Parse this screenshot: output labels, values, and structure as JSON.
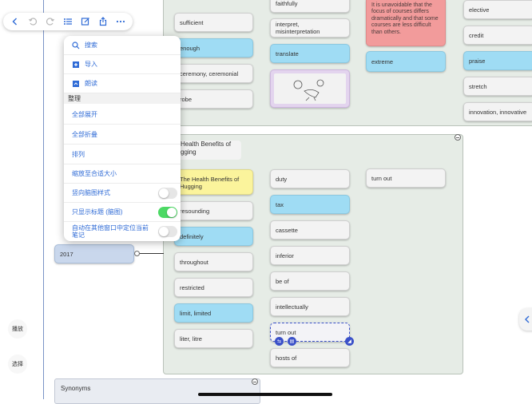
{
  "toolbar": {
    "icons": [
      "back-icon",
      "undo-icon",
      "redo-icon",
      "outline-icon",
      "edit-icon",
      "share-icon",
      "more-icon"
    ]
  },
  "menu": {
    "search": "搜索",
    "import": "导入",
    "read_aloud": "朗读",
    "section_organize": "整理",
    "expand_all": "全部展开",
    "collapse_all": "全部折叠",
    "arrange": "排列",
    "fit_size": "缩放至合适大小",
    "vertical_style": "竖向脑图样式",
    "show_titles_only": "只显示标题 (脑图)",
    "auto_locate_line1": "自动在其他窗口中定位当前",
    "auto_locate_line2": "笔记",
    "toggles": {
      "vertical_style": false,
      "show_titles_only": true,
      "auto_locate": false
    }
  },
  "side_buttons": {
    "play": "播放",
    "select": "选择"
  },
  "top_group": {
    "col1": [
      "sufficient",
      "enough",
      "ceremony, ceremonial",
      "robe"
    ],
    "col2": [
      "faithfully",
      "interpret, misinterpretation",
      "translate"
    ],
    "col3_note": "It is unavoidable that the focus of courses differs dramatically and that some courses are less difficult than others.",
    "col3_extreme": "extreme",
    "col4": [
      "elective",
      "credit",
      "praise",
      "stretch",
      "innovation, innovative"
    ]
  },
  "node_2017": "2017",
  "mid_group": {
    "title": "Health Benefits of gging",
    "col1": [
      "The Health Benefits of Hugging",
      "resounding",
      "definitely",
      "throughout",
      "restricted",
      "limit, limited",
      "liter, litre"
    ],
    "col2": [
      "duty",
      "tax",
      "cassette",
      "inferior",
      "be of",
      "intellectually",
      "turn out",
      "hosts of"
    ],
    "col3": [
      "turn out"
    ]
  },
  "synonyms": {
    "title": "Synonyms"
  }
}
